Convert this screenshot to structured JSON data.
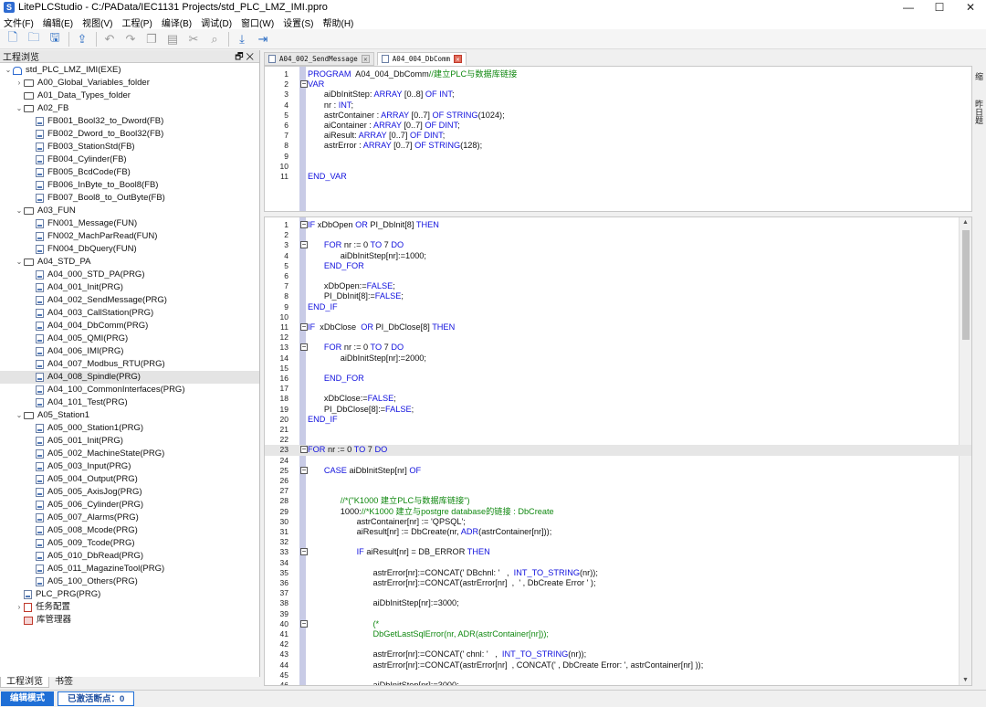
{
  "window": {
    "title": "LitePLCStudio - C:/PAData/IEC1131 Projects/std_PLC_LMZ_IMI.ppro",
    "controls": [
      "—",
      "☐",
      "✕"
    ]
  },
  "menu": [
    "文件(F)",
    "编辑(E)",
    "视图(V)",
    "工程(P)",
    "编译(B)",
    "调试(D)",
    "窗口(W)",
    "设置(S)",
    "帮助(H)"
  ],
  "toolbar_icons": [
    "new-file-icon",
    "open-folder-icon",
    "save-icon",
    "upload-icon",
    "undo-icon",
    "redo-icon",
    "copy-icon",
    "paste-icon",
    "cut-icon",
    "find-icon",
    "download-icon",
    "import-icon"
  ],
  "left_panel": {
    "title": "工程浏览",
    "pin": "🗗 ✕",
    "tree": [
      {
        "label": "std_PLC_LMZ_IMI(EXE)",
        "level": 0,
        "type": "root",
        "exp": "v"
      },
      {
        "label": "A00_Global_Variables_folder",
        "level": 1,
        "type": "folder",
        "exp": ">"
      },
      {
        "label": "A01_Data_Types_folder",
        "level": 1,
        "type": "folder",
        "exp": ""
      },
      {
        "label": "A02_FB",
        "level": 1,
        "type": "folder",
        "exp": "v"
      },
      {
        "label": "FB001_Bool32_to_Dword(FB)",
        "level": 2,
        "type": "doc"
      },
      {
        "label": "FB002_Dword_to_Bool32(FB)",
        "level": 2,
        "type": "doc"
      },
      {
        "label": "FB003_StationStd(FB)",
        "level": 2,
        "type": "doc"
      },
      {
        "label": "FB004_Cylinder(FB)",
        "level": 2,
        "type": "doc"
      },
      {
        "label": "FB005_BcdCode(FB)",
        "level": 2,
        "type": "doc"
      },
      {
        "label": "FB006_InByte_to_Bool8(FB)",
        "level": 2,
        "type": "doc"
      },
      {
        "label": "FB007_Bool8_to_OutByte(FB)",
        "level": 2,
        "type": "doc"
      },
      {
        "label": "A03_FUN",
        "level": 1,
        "type": "folder",
        "exp": "v"
      },
      {
        "label": "FN001_Message(FUN)",
        "level": 2,
        "type": "doc"
      },
      {
        "label": "FN002_MachParRead(FUN)",
        "level": 2,
        "type": "doc"
      },
      {
        "label": "FN004_DbQuery(FUN)",
        "level": 2,
        "type": "doc"
      },
      {
        "label": "A04_STD_PA",
        "level": 1,
        "type": "folder",
        "exp": "v"
      },
      {
        "label": "A04_000_STD_PA(PRG)",
        "level": 2,
        "type": "doc"
      },
      {
        "label": "A04_001_Init(PRG)",
        "level": 2,
        "type": "doc"
      },
      {
        "label": "A04_002_SendMessage(PRG)",
        "level": 2,
        "type": "doc"
      },
      {
        "label": "A04_003_CallStation(PRG)",
        "level": 2,
        "type": "doc"
      },
      {
        "label": "A04_004_DbComm(PRG)",
        "level": 2,
        "type": "doc"
      },
      {
        "label": "A04_005_QMI(PRG)",
        "level": 2,
        "type": "doc"
      },
      {
        "label": "A04_006_IMI(PRG)",
        "level": 2,
        "type": "doc"
      },
      {
        "label": "A04_007_Modbus_RTU(PRG)",
        "level": 2,
        "type": "doc"
      },
      {
        "label": "A04_008_Spindle(PRG)",
        "level": 2,
        "type": "doc",
        "selected": true
      },
      {
        "label": "A04_100_CommonInterfaces(PRG)",
        "level": 2,
        "type": "doc"
      },
      {
        "label": "A04_101_Test(PRG)",
        "level": 2,
        "type": "doc"
      },
      {
        "label": "A05_Station1",
        "level": 1,
        "type": "folder",
        "exp": "v"
      },
      {
        "label": "A05_000_Station1(PRG)",
        "level": 2,
        "type": "doc"
      },
      {
        "label": "A05_001_Init(PRG)",
        "level": 2,
        "type": "doc"
      },
      {
        "label": "A05_002_MachineState(PRG)",
        "level": 2,
        "type": "doc"
      },
      {
        "label": "A05_003_Input(PRG)",
        "level": 2,
        "type": "doc"
      },
      {
        "label": "A05_004_Output(PRG)",
        "level": 2,
        "type": "doc"
      },
      {
        "label": "A05_005_AxisJog(PRG)",
        "level": 2,
        "type": "doc"
      },
      {
        "label": "A05_006_Cylinder(PRG)",
        "level": 2,
        "type": "doc"
      },
      {
        "label": "A05_007_Alarms(PRG)",
        "level": 2,
        "type": "doc"
      },
      {
        "label": "A05_008_Mcode(PRG)",
        "level": 2,
        "type": "doc"
      },
      {
        "label": "A05_009_Tcode(PRG)",
        "level": 2,
        "type": "doc"
      },
      {
        "label": "A05_010_DbRead(PRG)",
        "level": 2,
        "type": "doc"
      },
      {
        "label": "A05_011_MagazineTool(PRG)",
        "level": 2,
        "type": "doc"
      },
      {
        "label": "A05_100_Others(PRG)",
        "level": 2,
        "type": "doc"
      },
      {
        "label": "PLC_PRG(PRG)",
        "level": 1,
        "type": "doc"
      },
      {
        "label": "任务配置",
        "level": 1,
        "type": "task",
        "exp": ">"
      },
      {
        "label": "库管理器",
        "level": 1,
        "type": "lib"
      }
    ],
    "bottom_tabs": [
      "工程浏览",
      "书签"
    ]
  },
  "editor": {
    "tabs": [
      {
        "label": "A04_002_SendMessage",
        "active": false
      },
      {
        "label": "A04_004_DbComm",
        "active": true
      }
    ],
    "right_strip": [
      "缩",
      "昨",
      "日",
      "题"
    ],
    "decl_lines": [
      {
        "n": "1",
        "fold": "",
        "html": "<span class=\"kw\">PROGRAM</span>  A04_004_DbComm<span class=\"cm\">//建立PLC与数据库链接</span>"
      },
      {
        "n": "2",
        "fold": "-",
        "html": "<span class=\"kw\">VAR</span>"
      },
      {
        "n": "3",
        "fold": "",
        "html": "       aiDbInitStep: <span class=\"kw\">ARRAY</span> [0..8] <span class=\"kw\">OF INT</span>;"
      },
      {
        "n": "4",
        "fold": "",
        "html": "       nr : <span class=\"kw\">INT</span>;"
      },
      {
        "n": "5",
        "fold": "",
        "html": "       astrContainer : <span class=\"kw\">ARRAY</span> [0..7] <span class=\"kw\">OF STRING</span>(1024);"
      },
      {
        "n": "6",
        "fold": "",
        "html": "       aiContainer : <span class=\"kw\">ARRAY</span> [0..7] <span class=\"kw\">OF DINT</span>;"
      },
      {
        "n": "7",
        "fold": "",
        "html": "       aiResult: <span class=\"kw\">ARRAY</span> [0..7] <span class=\"kw\">OF DINT</span>;"
      },
      {
        "n": "8",
        "fold": "",
        "html": "       astrError : <span class=\"kw\">ARRAY</span> [0..7] <span class=\"kw\">OF STRING</span>(128);"
      },
      {
        "n": "9",
        "fold": "",
        "html": ""
      },
      {
        "n": "10",
        "fold": "",
        "html": ""
      },
      {
        "n": "11",
        "fold": "",
        "html": "<span class=\"kw\">END_VAR</span>"
      }
    ],
    "impl_lines": [
      {
        "n": "1",
        "fold": "-",
        "html": "<span class=\"kw\">IF</span> xDbOpen <span class=\"kw\">OR</span> PI_DbInit[8] <span class=\"kw\">THEN</span>"
      },
      {
        "n": "2",
        "fold": "",
        "html": ""
      },
      {
        "n": "3",
        "fold": "-",
        "html": "       <span class=\"kw\">FOR</span> nr := 0 <span class=\"kw\">TO</span> 7 <span class=\"kw\">DO</span>"
      },
      {
        "n": "4",
        "fold": "",
        "html": "              aiDbInitStep[nr]:=1000;"
      },
      {
        "n": "5",
        "fold": "",
        "html": "       <span class=\"kw\">END_FOR</span>"
      },
      {
        "n": "6",
        "fold": "",
        "html": ""
      },
      {
        "n": "7",
        "fold": "",
        "html": "       xDbOpen:=<span class=\"kw\">FALSE</span>;"
      },
      {
        "n": "8",
        "fold": "",
        "html": "       PI_DbInit[8]:=<span class=\"kw\">FALSE</span>;"
      },
      {
        "n": "9",
        "fold": "",
        "html": "<span class=\"kw\">END_IF</span>"
      },
      {
        "n": "10",
        "fold": "",
        "html": ""
      },
      {
        "n": "11",
        "fold": "-",
        "html": "<span class=\"kw\">IF</span>  xDbClose  <span class=\"kw\">OR</span> PI_DbClose[8] <span class=\"kw\">THEN</span>"
      },
      {
        "n": "12",
        "fold": "",
        "html": ""
      },
      {
        "n": "13",
        "fold": "-",
        "html": "       <span class=\"kw\">FOR</span> nr := 0 <span class=\"kw\">TO</span> 7 <span class=\"kw\">DO</span>"
      },
      {
        "n": "14",
        "fold": "",
        "html": "              aiDbInitStep[nr]:=2000;"
      },
      {
        "n": "15",
        "fold": "",
        "html": ""
      },
      {
        "n": "16",
        "fold": "",
        "html": "       <span class=\"kw\">END_FOR</span>"
      },
      {
        "n": "17",
        "fold": "",
        "html": ""
      },
      {
        "n": "18",
        "fold": "",
        "html": "       xDbClose:=<span class=\"kw\">FALSE</span>;"
      },
      {
        "n": "19",
        "fold": "",
        "html": "       PI_DbClose[8]:=<span class=\"kw\">FALSE</span>;"
      },
      {
        "n": "20",
        "fold": "",
        "html": "<span class=\"kw\">END_IF</span>"
      },
      {
        "n": "21",
        "fold": "",
        "html": ""
      },
      {
        "n": "22",
        "fold": "",
        "html": ""
      },
      {
        "n": "23",
        "fold": "-",
        "html": "<span class=\"kw\">FOR</span> nr := 0 <span class=\"kw\">TO</span> 7 <span class=\"kw\">DO</span>",
        "current": true
      },
      {
        "n": "24",
        "fold": "",
        "html": ""
      },
      {
        "n": "25",
        "fold": "-",
        "html": "       <span class=\"kw\">CASE</span> aiDbInitStep[nr] <span class=\"kw\">OF</span>"
      },
      {
        "n": "26",
        "fold": "",
        "html": ""
      },
      {
        "n": "27",
        "fold": "",
        "html": ""
      },
      {
        "n": "28",
        "fold": "",
        "html": "              <span class=\"cm\">//*(\"K1000 建立PLC与数据库链接\")</span>"
      },
      {
        "n": "29",
        "fold": "",
        "html": "              1000:<span class=\"cm\">//*K1000 建立与postgre database的链接 : DbCreate</span>"
      },
      {
        "n": "30",
        "fold": "",
        "html": "                     astrContainer[nr] := 'QPSQL';"
      },
      {
        "n": "31",
        "fold": "",
        "html": "                     aiResult[nr] := DbCreate(nr, <span class=\"kw\">ADR</span>(astrContainer[nr]));"
      },
      {
        "n": "32",
        "fold": "",
        "html": ""
      },
      {
        "n": "33",
        "fold": "-",
        "html": "                     <span class=\"kw\">IF</span> aiResult[nr] = DB_ERROR <span class=\"kw\">THEN</span>"
      },
      {
        "n": "34",
        "fold": "",
        "html": ""
      },
      {
        "n": "35",
        "fold": "",
        "html": "                            astrError[nr]:=CONCAT(' DBchnl: '   ,  <span class=\"kw\">INT_TO_STRING</span>(nr));"
      },
      {
        "n": "36",
        "fold": "",
        "html": "                            astrError[nr]:=CONCAT(astrError[nr]  ,  ' , DbCreate Error ' );"
      },
      {
        "n": "37",
        "fold": "",
        "html": ""
      },
      {
        "n": "38",
        "fold": "",
        "html": "                            aiDbInitStep[nr]:=3000;"
      },
      {
        "n": "39",
        "fold": "",
        "html": ""
      },
      {
        "n": "40",
        "fold": "-",
        "html": "                            <span class=\"cm\">(*</span>"
      },
      {
        "n": "41",
        "fold": "",
        "html": "                            <span class=\"cm\">DbGetLastSqlError(nr, ADR(astrContainer[nr]));</span>"
      },
      {
        "n": "42",
        "fold": "",
        "html": ""
      },
      {
        "n": "43",
        "fold": "",
        "html": "                            astrError[nr]:=CONCAT(' chnl: '   ,  <span class=\"kw\">INT_TO_STRING</span>(nr));"
      },
      {
        "n": "44",
        "fold": "",
        "html": "                            astrError[nr]:=CONCAT(astrError[nr]  , CONCAT(' , DbCreate Error: ', astrContainer[nr] ));"
      },
      {
        "n": "45",
        "fold": "",
        "html": ""
      },
      {
        "n": "46",
        "fold": "",
        "html": "                            aiDbInitStep[nr]:=3000;"
      }
    ]
  },
  "status": {
    "mode": "编辑模式",
    "breakpoints": "已激活断点：0"
  }
}
